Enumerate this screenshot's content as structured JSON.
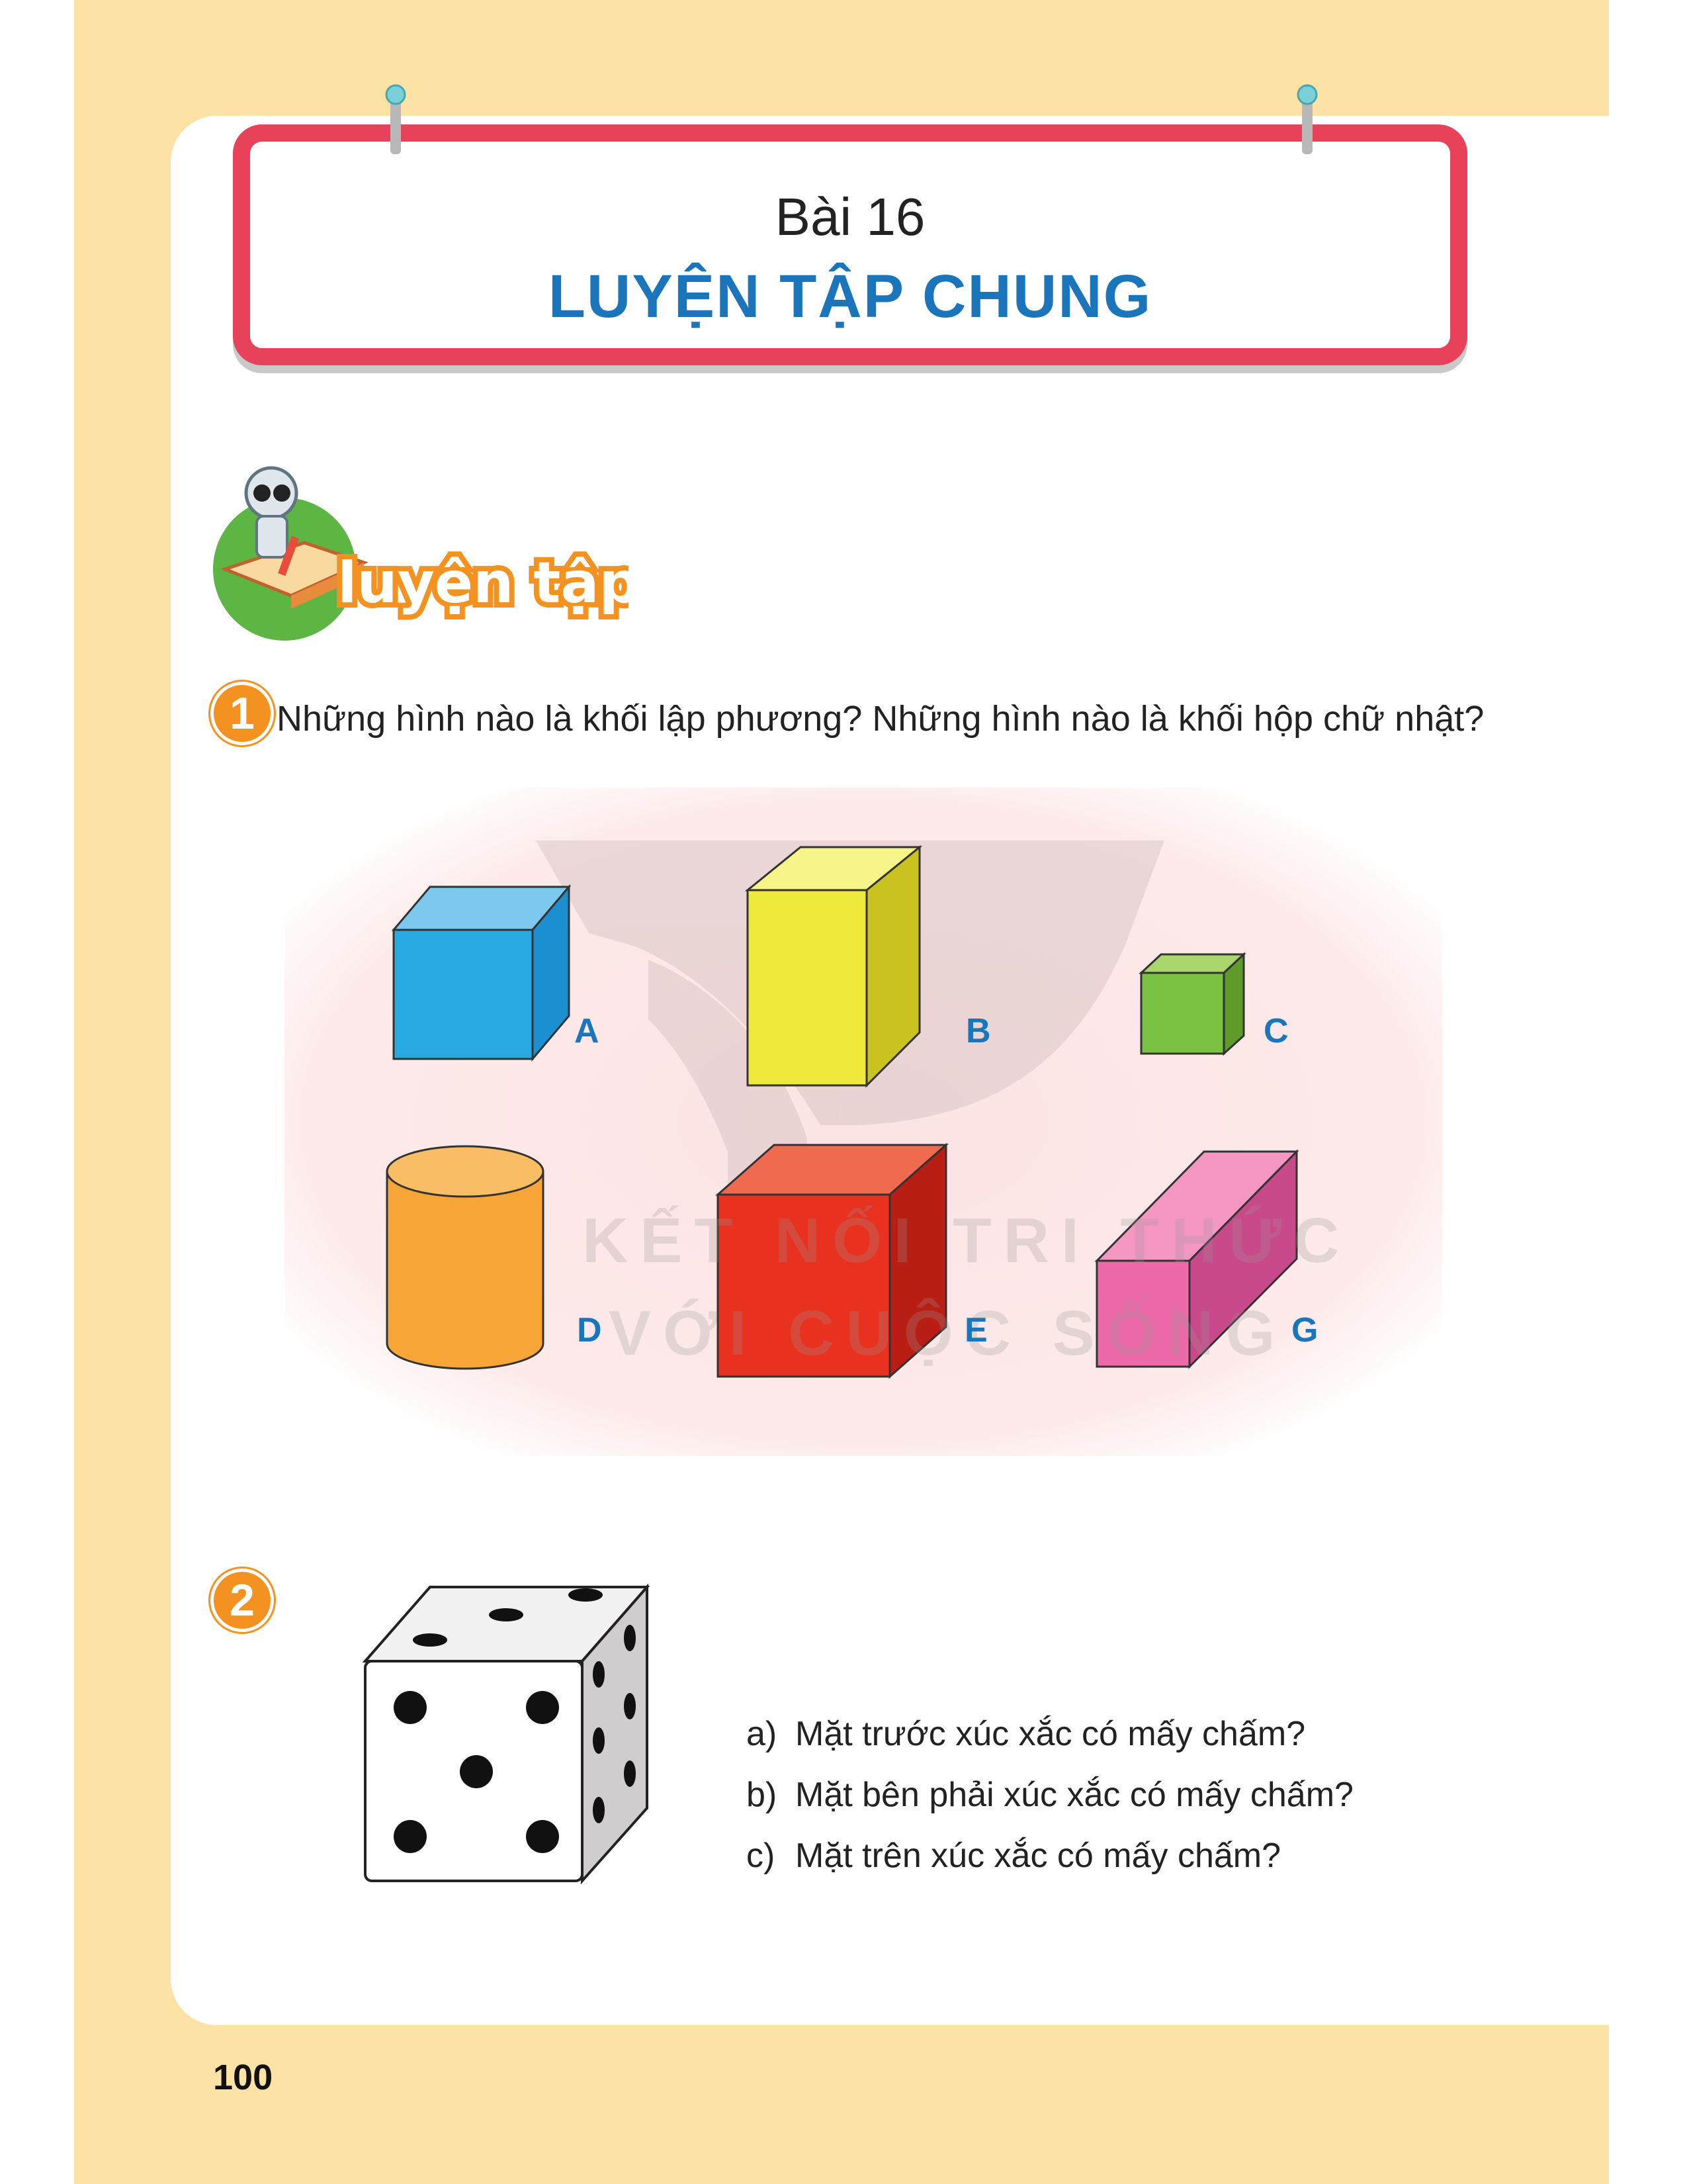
{
  "header": {
    "lesson_number": "Bài 16",
    "lesson_title": "LUYỆN TẬP CHUNG"
  },
  "practice_badge": {
    "label": "luyện tập"
  },
  "question1": {
    "number": "1",
    "text": "Những hình nào là khối lập phương? Những hình nào là khối hộp chữ nhật?",
    "shape_labels": [
      "A",
      "B",
      "C",
      "D",
      "E",
      "G"
    ],
    "colors": {
      "A": "#29a9e1",
      "B": "#eeea3c",
      "C": "#7cc242",
      "D": "#f6a536",
      "E": "#e8321f",
      "G": "#ec6aa8"
    }
  },
  "watermark": {
    "line1": "KẾT NỐI TRI THỨC",
    "line2": "VỚI CUỘC SỐNG"
  },
  "question2": {
    "number": "2",
    "items": [
      {
        "letter": "a)",
        "text": "Mặt trước xúc xắc có mấy chấm?"
      },
      {
        "letter": "b)",
        "text": "Mặt bên phải xúc xắc có mấy chấm?"
      },
      {
        "letter": "c)",
        "text": "Mặt trên xúc xắc có mấy chấm?"
      }
    ]
  },
  "page_number": "100",
  "theme": {
    "page_bg": "#fde2a6",
    "board_border": "#e8425a",
    "title_blue": "#1b75bb",
    "badge_orange": "#f39221"
  }
}
